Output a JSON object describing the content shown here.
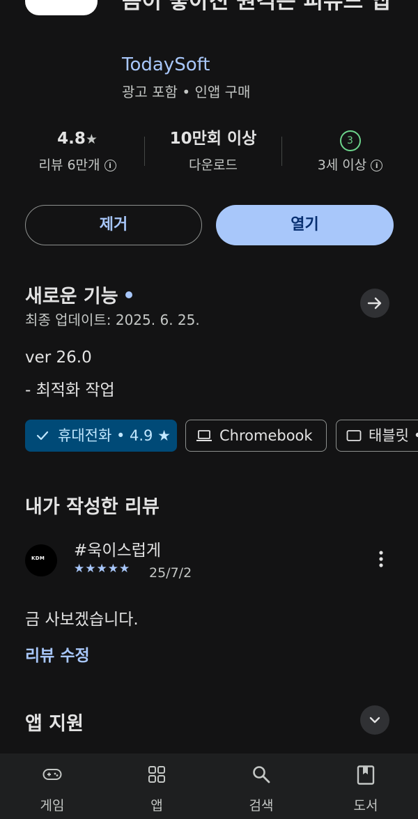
{
  "app": {
    "title": "즘이 좋아진 원격은 피뮤드 앱",
    "developer": "TodaySoft",
    "meta": "광고 포함 • 인앱 구매"
  },
  "stats": {
    "rating": "4.8",
    "rating_star": "★",
    "reviews_label": "리뷰 6만개",
    "downloads": "10만회 이상",
    "downloads_label": "다운로드",
    "age_badge": "3",
    "age_label": "3세 이상",
    "info_glyph": "i"
  },
  "buttons": {
    "remove": "제거",
    "open": "열기"
  },
  "whats_new": {
    "title": "새로운 기능",
    "updated": "최종 업데이트: 2025. 6. 25.",
    "version": "ver 26.0",
    "note": "- 최적화 작업"
  },
  "device_chips": {
    "phone": "휴대전화 • 4.9 ★",
    "chromebook": "Chromebook",
    "tablet": "태블릿 •"
  },
  "my_review": {
    "section_title": "내가 작성한 리뷰",
    "avatar_text": "KDM",
    "reviewer": "#욱이스럽게",
    "stars": "★★★★★",
    "rating_value": 5,
    "date": "25/7/2",
    "text": "금 사보겠습니다.",
    "edit_link": "리뷰 수정"
  },
  "app_support": {
    "title": "앱 지원"
  },
  "bottom_nav": {
    "games": "게임",
    "apps": "앱",
    "search": "검색",
    "books": "도서"
  },
  "colors": {
    "background": "#131314",
    "accent": "#a8c7fa",
    "chip_selected": "#004a77",
    "age_green": "#6dd58c"
  }
}
